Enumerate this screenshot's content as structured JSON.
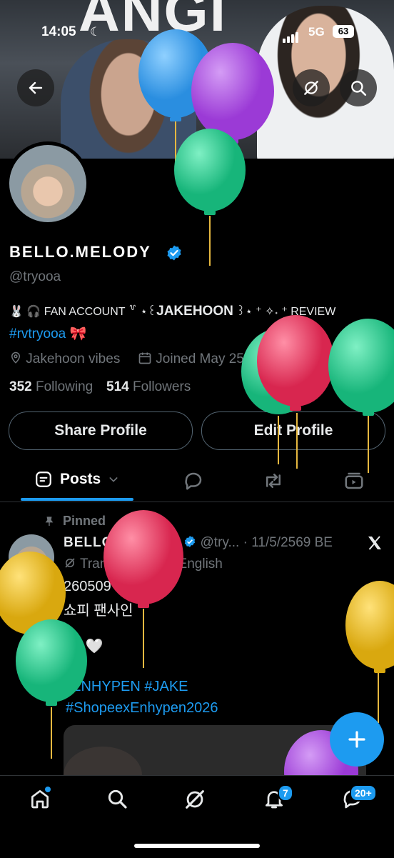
{
  "status_bar": {
    "time": "14:05",
    "network": "5G",
    "battery": "63"
  },
  "header": {
    "back_icon": "arrow-left-icon",
    "grok_icon": "grok-icon",
    "search_icon": "search-icon"
  },
  "profile": {
    "display_name": "BELLO.MELODY",
    "handle": "@tryooa",
    "bio_line1_prefix": "🐰 🎧 FAN ACCOUNT ꒷ ⋆꒰",
    "bio_line1_name": "JAKEHOON",
    "bio_line1_suffix": "꒱⋆ ⁺ ✧˖ ⁺ REVIEW",
    "bio_line2": "#rvtryooa 🎀",
    "location": "Jakehoon vibes",
    "joined": "Joined May 2567 BE",
    "following_count": "352",
    "following_label": "Following",
    "followers_count": "514",
    "followers_label": "Followers"
  },
  "actions": {
    "share": "Share Profile",
    "edit": "Edit Profile"
  },
  "tabs": {
    "posts": "Posts"
  },
  "post": {
    "pinned_label": "Pinned",
    "name": "BELLO.MELODY",
    "handle_date": "@try... · 11/5/2569 BE",
    "translated": "Translated from English",
    "line1": "260509 ♡",
    "line2": "쇼피 팬사인",
    "line3": "🦮 🤍",
    "hashtags1": "#ENHYPEN #JAKE",
    "hashtags2": "#ShopeexEnhypen2026"
  },
  "nav": {
    "notifications_badge": "7",
    "messages_badge": "20+"
  },
  "colors": {
    "accent": "#1d9bf0",
    "background": "#000000",
    "muted": "#71767b"
  }
}
